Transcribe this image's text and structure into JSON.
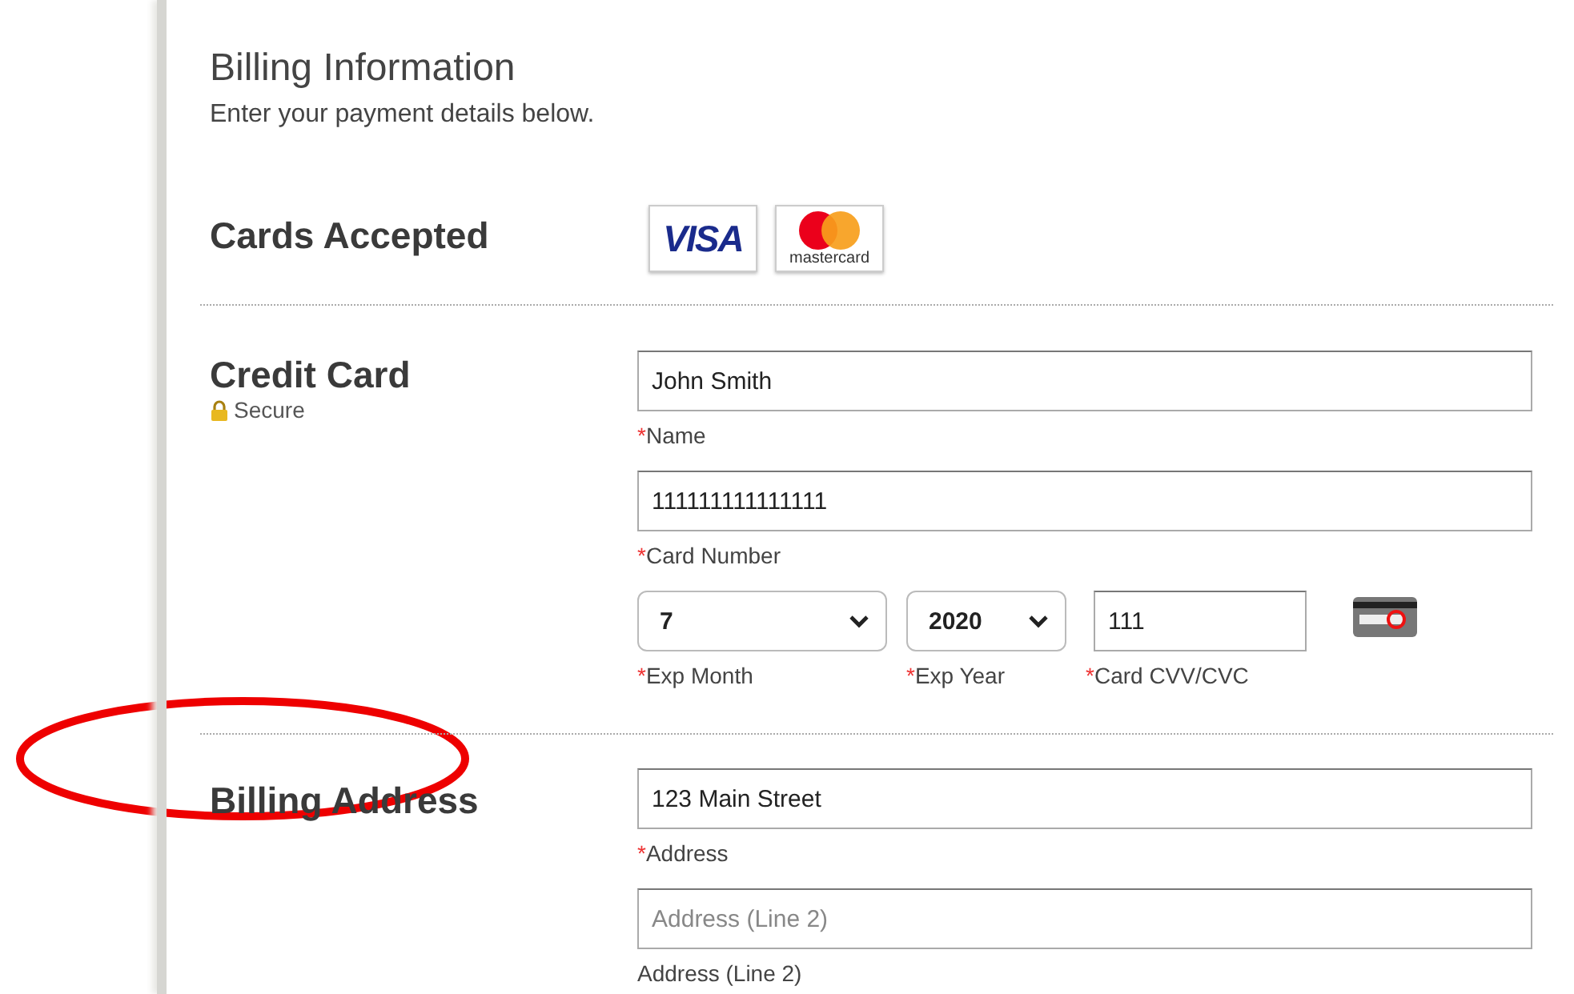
{
  "header": {
    "title": "Billing Information",
    "subtitle": "Enter your payment details below."
  },
  "sections": [
    {
      "kind": "cards",
      "title": "Cards Accepted",
      "cards": [
        {
          "kind": "visa",
          "label": "VISA"
        },
        {
          "kind": "mastercard",
          "label": "mastercard"
        }
      ]
    },
    {
      "kind": "fields",
      "title": "Credit Card",
      "note": "Secure",
      "rows": [
        [
          {
            "kind": "text",
            "value": "John Smith",
            "mark": "*",
            "label": "Name"
          }
        ],
        [
          {
            "kind": "text",
            "value": "111111111111111",
            "mark": "*",
            "label": "Card Number"
          }
        ],
        [
          {
            "kind": "select",
            "value": "7",
            "mark": "*",
            "label": "Exp Month"
          },
          {
            "kind": "select",
            "value": "2020",
            "mark": "*",
            "label": "Exp Year"
          },
          {
            "kind": "cvv",
            "value": "111",
            "mark": "*",
            "label": "Card CVV/CVC"
          }
        ]
      ]
    },
    {
      "kind": "fields",
      "title": "Billing Address",
      "rows": [
        [
          {
            "kind": "text",
            "value": "123 Main Street",
            "mark": "*",
            "label": "Address"
          }
        ],
        [
          {
            "kind": "text",
            "placeholder": "Address (Line 2)",
            "label": "Address (Line 2)"
          }
        ]
      ]
    }
  ],
  "annotations": [
    {
      "kind": "ellipse"
    }
  ]
}
